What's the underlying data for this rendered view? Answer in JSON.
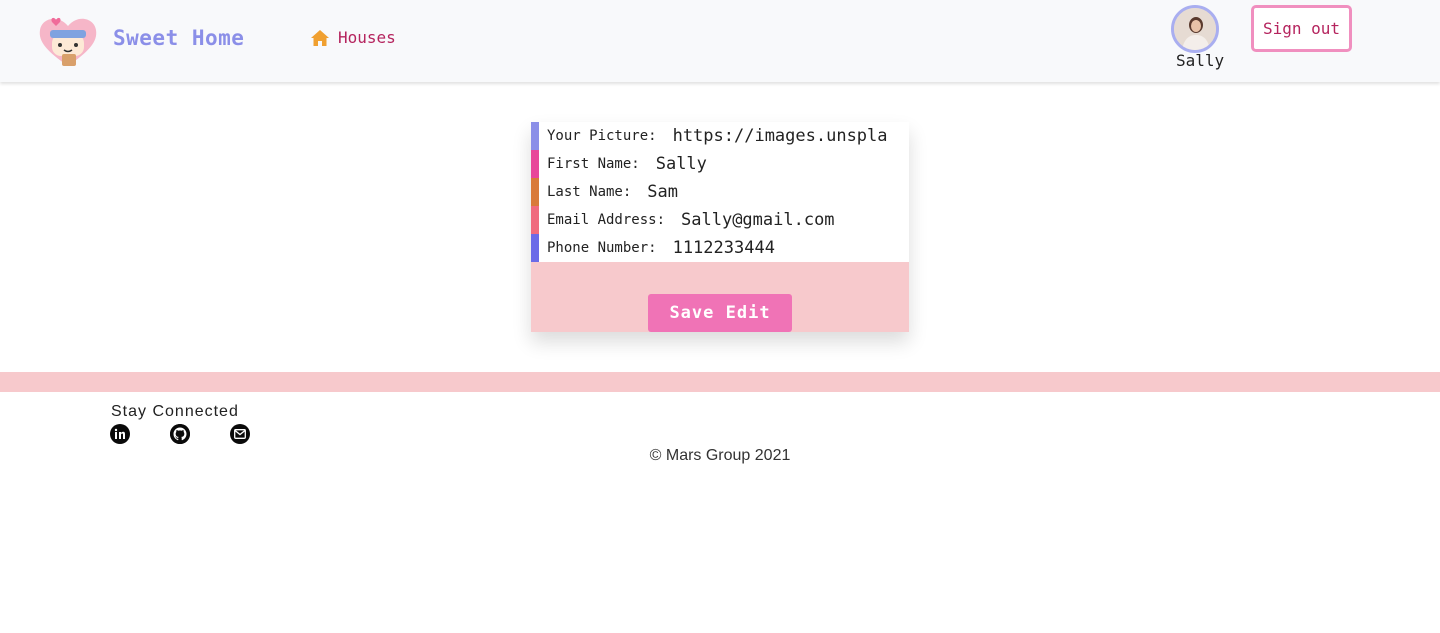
{
  "header": {
    "brand": "Sweet Home",
    "nav": [
      {
        "label": "Houses",
        "icon": "home-icon"
      }
    ],
    "user_name": "Sally",
    "signout_label": "Sign out"
  },
  "form": {
    "fields": [
      {
        "label": "Your Picture:",
        "value": "https://images.unspla",
        "accent": "#8b8fe8"
      },
      {
        "label": "First Name:",
        "value": "Sally",
        "accent": "#e8479a"
      },
      {
        "label": "Last Name:",
        "value": "Sam",
        "accent": "#d97a3a"
      },
      {
        "label": "Email Address:",
        "value": "Sally@gmail.com",
        "accent": "#f06b7f"
      },
      {
        "label": "Phone Number:",
        "value": "1112233444",
        "accent": "#6b6be8"
      }
    ],
    "save_label": "Save Edit"
  },
  "footer": {
    "stay_connected": "Stay Connected",
    "social": [
      {
        "icon": "linkedin-icon"
      },
      {
        "icon": "github-icon"
      },
      {
        "icon": "email-icon"
      }
    ],
    "copyright": "© Mars Group 2021"
  },
  "colors": {
    "brand": "#8b8fe8",
    "accent_text": "#b5245e",
    "button": "#f073b6",
    "band": "#f7c9cc"
  }
}
